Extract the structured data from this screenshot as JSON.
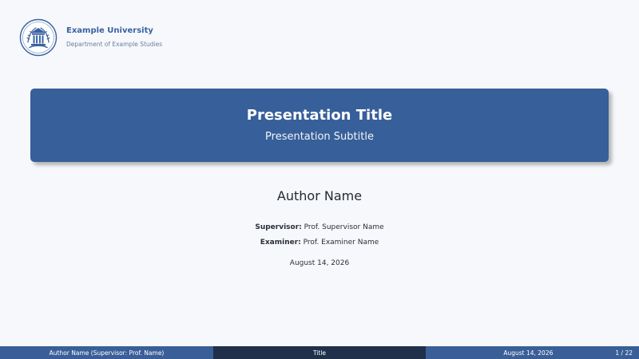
{
  "header": {
    "university": "Example University",
    "department": "Department of Example Studies",
    "logo_icon": "university-seal-icon"
  },
  "title_block": {
    "title": "Presentation Title",
    "subtitle": "Presentation Subtitle"
  },
  "author": {
    "name": "Author Name"
  },
  "people": {
    "supervisor_label": "Supervisor:",
    "supervisor_name": "Prof. Supervisor Name",
    "examiner_label": "Examiner:",
    "examiner_name": "Prof. Examiner Name"
  },
  "date": "August 14, 2026",
  "footer": {
    "left_text": "Author Name  (Supervisor: Prof. Name)",
    "middle_text": "Title",
    "right_date": "August 14, 2026",
    "page_number": "1 / 22"
  },
  "colors": {
    "page_background": "#f6f8fb",
    "primary_blue": "#375f99",
    "dark_navy": "#20304a",
    "text_dark": "#252a33"
  }
}
